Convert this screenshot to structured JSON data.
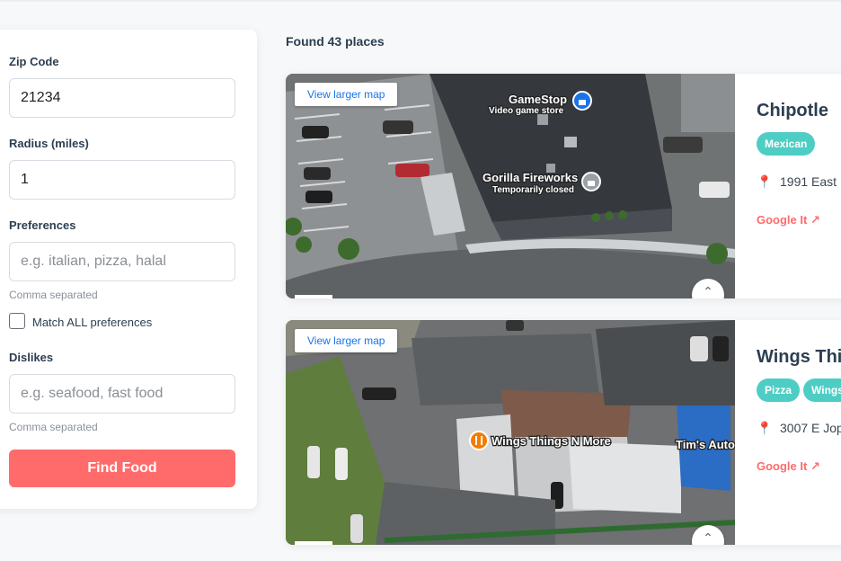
{
  "form": {
    "zip_label": "Zip Code",
    "zip_value": "21234",
    "radius_label": "Radius (miles)",
    "radius_value": "1",
    "preferences_label": "Preferences",
    "preferences_placeholder": "e.g. italian, pizza, halal",
    "preferences_hint": "Comma separated",
    "match_all_label": "Match ALL preferences",
    "match_all_checked": false,
    "dislikes_label": "Dislikes",
    "dislikes_placeholder": "e.g. seafood, fast food",
    "dislikes_hint": "Comma separated",
    "submit_label": "Find Food"
  },
  "results": {
    "summary": "Found 43 places",
    "items": [
      {
        "map_link": "View larger map",
        "map_labels": [
          "GameStop",
          "Video game store",
          "Gorilla Fireworks",
          "Temporarily closed"
        ],
        "name": "Chipotle",
        "tags": [
          "Mexican"
        ],
        "address": "1991 East",
        "google_link": "Google It ↗"
      },
      {
        "map_link": "View larger map",
        "map_labels": [
          "Wings Things N More",
          "Tim's Auto"
        ],
        "name": "Wings Thi",
        "tags": [
          "Pizza",
          "Wings"
        ],
        "address": "3007 E Jop",
        "google_link": "Google It ↗"
      }
    ]
  },
  "icons": {
    "pin": "📍",
    "expand": "⌃",
    "lock": "lock-icon",
    "food": "restaurant-icon"
  },
  "colors": {
    "accent": "#ff6b6b",
    "tag": "#4ecdc4",
    "link": "#1a73e8"
  }
}
